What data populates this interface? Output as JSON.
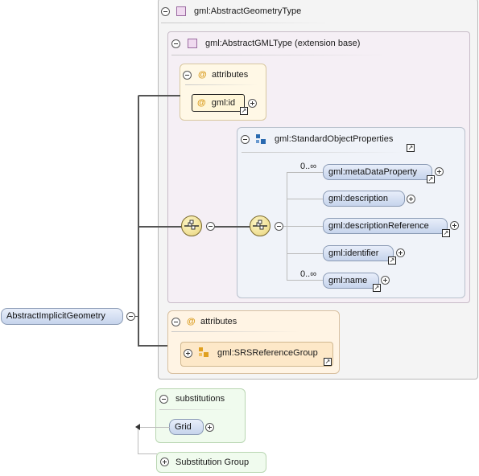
{
  "root": {
    "label": "AbstractImplicitGeometry"
  },
  "geometry_type": {
    "title": "gml:AbstractGeometryType"
  },
  "gml_type": {
    "title": "gml:AbstractGMLType (extension base)"
  },
  "attributes_top": {
    "title": "attributes",
    "item": "gml:id"
  },
  "standard_props": {
    "title": "gml:StandardObjectProperties",
    "items": [
      {
        "label": "gml:metaDataProperty",
        "occurs": "0..∞"
      },
      {
        "label": "gml:description",
        "occurs": ""
      },
      {
        "label": "gml:descriptionReference",
        "occurs": ""
      },
      {
        "label": "gml:identifier",
        "occurs": ""
      },
      {
        "label": "gml:name",
        "occurs": "0..∞"
      }
    ]
  },
  "attributes_bottom": {
    "title": "attributes",
    "item": "gml:SRSReferenceGroup"
  },
  "substitutions": {
    "title": "substitutions",
    "item": "Grid"
  },
  "substitution_group": {
    "title": "Substitution Group"
  },
  "colors": {
    "element_fill": "#c6d4ec",
    "attribute_fill": "#fff8e6",
    "substitution_fill": "#f0fbee"
  }
}
